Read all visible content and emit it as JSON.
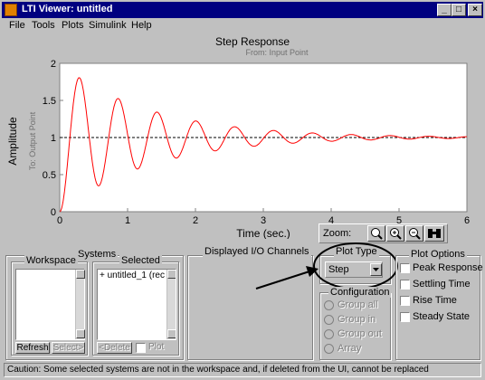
{
  "window": {
    "title": "LTI Viewer: untitled",
    "controls": {
      "minimize": "_",
      "maximize": "□",
      "close": "×"
    }
  },
  "menu": [
    "File",
    "Tools",
    "Plots",
    "Simulink",
    "Help"
  ],
  "plot": {
    "title": "Step Response",
    "subtitle": "From: Input Point",
    "ylabel": "Amplitude",
    "ylabel_small": "To: Output Point",
    "xlabel": "Time (sec.)"
  },
  "zoom": {
    "label": "Zoom:",
    "icons": [
      "zoom-in-x-icon",
      "zoom-in-icon",
      "zoom-out-icon",
      "binoculars-icon"
    ]
  },
  "systems": {
    "title": "Systems",
    "workspace": {
      "title": "Workspace",
      "items": [],
      "refresh_label": "Refresh",
      "select_label": "Select>"
    },
    "selected": {
      "title": "Selected",
      "items": [
        "+ untitled_1 (rec"
      ],
      "delete_label": "<Delete",
      "plot_label": "Plot"
    }
  },
  "io_channels": {
    "title": "Displayed I/O Channels"
  },
  "plot_type": {
    "title": "Plot Type",
    "value": "Step"
  },
  "configuration": {
    "title": "Configuration",
    "options": [
      "Group all",
      "Group in",
      "Group out",
      "Array"
    ]
  },
  "plot_options": {
    "title": "Plot Options",
    "options": [
      "Peak Response",
      "Settling Time",
      "Rise Time",
      "Steady State"
    ]
  },
  "status": "Caution: Some selected systems are not in the workspace and, if deleted from the UI, cannot be replaced",
  "chart_data": {
    "type": "line",
    "title": "Step Response",
    "subtitle": "From: Input Point",
    "xlabel": "Time (sec.)",
    "ylabel": "Amplitude",
    "xlim": [
      0,
      6
    ],
    "ylim": [
      0,
      2
    ],
    "xticks": [
      0,
      1,
      2,
      3,
      4,
      5,
      6
    ],
    "yticks": [
      0,
      0.5,
      1,
      1.5,
      2
    ],
    "reference_line": 1,
    "series": [
      {
        "color": "#ff0000",
        "model": "damped step",
        "zeta": 0.068,
        "omega_n": 11.0,
        "peaks": [
          [
            0.29,
            1.67
          ],
          [
            0.86,
            1.46
          ],
          [
            1.43,
            1.27
          ],
          [
            2.0,
            1.16
          ],
          [
            2.57,
            1.09
          ],
          [
            3.14,
            1.05
          ]
        ]
      }
    ]
  }
}
